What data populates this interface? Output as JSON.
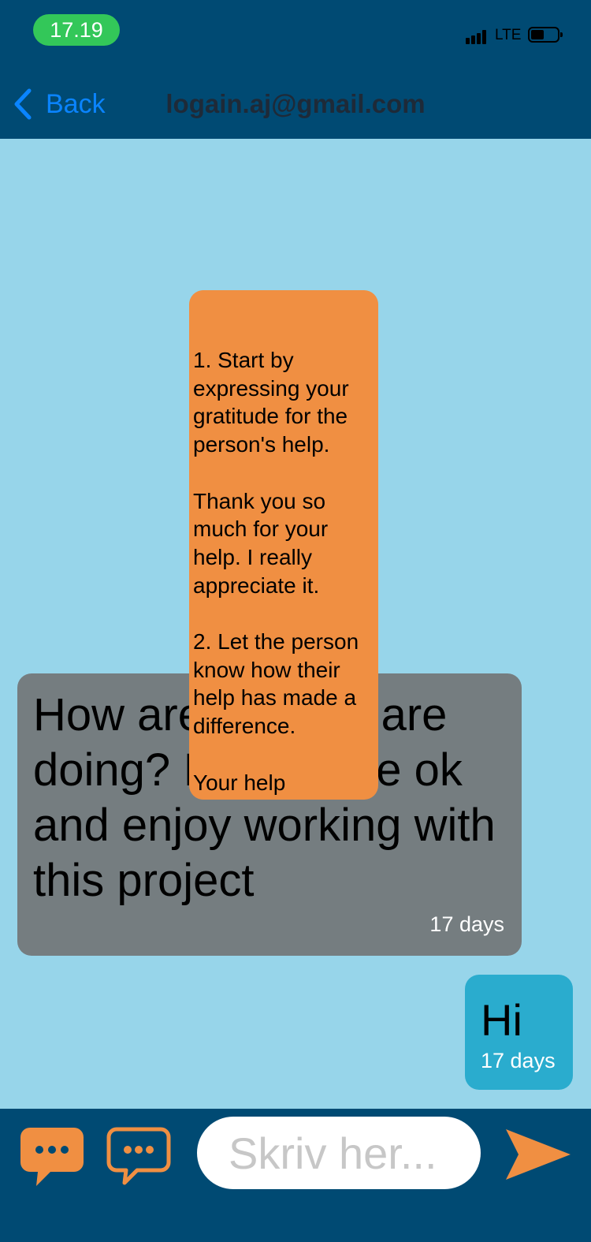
{
  "status_bar": {
    "time": "17.19",
    "network": "LTE"
  },
  "nav": {
    "back_label": "Back",
    "title": "logain.aj@gmail.com"
  },
  "messages": [
    {
      "direction": "received",
      "text": "How are you? Hope you are doing? I hope you are ok and enjoy working with this project",
      "visible_text": "How are              are doing? I             re ok and enjoy working with this project",
      "time": "17 days"
    },
    {
      "direction": "sent",
      "text": "Hi",
      "time": "17 days"
    }
  ],
  "suggestion_popup": {
    "text": "1. Start by expressing your gratitude for the person's help.\n\nThank you so much for your help. I really appreciate it.\n\n2. Let the person know how their help has made a difference.\n\nYour help"
  },
  "input_bar": {
    "placeholder": "Skriv her..."
  },
  "colors": {
    "header_bg": "#004a73",
    "chat_bg": "#97d5ea",
    "received_bubble": "#757d80",
    "sent_bubble": "#2aacce",
    "popup_bg": "#f08f42",
    "accent_orange": "#f08f42",
    "link_blue": "#0a84ff",
    "time_pill": "#33c759"
  },
  "icons": {
    "back": "chevron-left-icon",
    "chat_filled": "chat-bubble-filled-icon",
    "chat_outline": "chat-bubble-outline-icon",
    "send": "send-arrow-icon"
  }
}
